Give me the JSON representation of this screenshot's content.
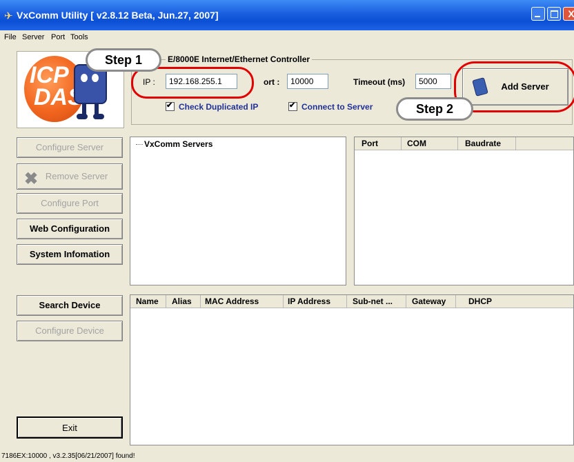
{
  "window": {
    "title": "VxComm Utility [ v2.8.12 Beta, Jun.27, 2007]",
    "close_glyph": "X"
  },
  "menu": [
    "File",
    "Server",
    "Port",
    "Tools"
  ],
  "logo": {
    "text_line1": "ICP",
    "text_line2": "DAS"
  },
  "connection": {
    "group_label": "E/8000E Internet/Ethernet Controller",
    "ip_label": "IP :",
    "ip_value": "192.168.255.1",
    "port_label": "ort :",
    "port_value": "10000",
    "timeout_label": "Timeout (ms)",
    "timeout_value": "5000",
    "check_duplicated_label": "Check Duplicated IP",
    "connect_to_server_label": "Connect to Server",
    "add_server_label": "Add Server"
  },
  "annotations": {
    "step1": "Step 1",
    "step2": "Step 2"
  },
  "side_buttons": {
    "configure_server": "Configure Server",
    "remove_server": "Remove Server",
    "configure_port": "Configure Port",
    "web_configuration": "Web Configuration",
    "system_information": "System Infomation",
    "search_device": "Search Device",
    "configure_device": "Configure Device",
    "exit": "Exit"
  },
  "server_tree": {
    "root_label": "VxComm Servers"
  },
  "port_table": {
    "columns": [
      "Port",
      "COM",
      "Baudrate"
    ]
  },
  "device_table": {
    "columns": [
      "Name",
      "Alias",
      "MAC Address",
      "IP Address",
      "Sub-net ...",
      "Gateway",
      "DHCP"
    ]
  },
  "status": {
    "text": "7186EX:10000 , v3.2.35[06/21/2007] found!"
  },
  "icons": [
    "app-icon",
    "remove-x-icon",
    "add-server-icon",
    "minimize-icon",
    "maximize-icon",
    "close-icon"
  ],
  "colors": {
    "title_bar": "#1a5ee0",
    "callout_red": "#e10000",
    "checkbox_text": "#20309a",
    "disabled_text": "#a3a3a3"
  }
}
